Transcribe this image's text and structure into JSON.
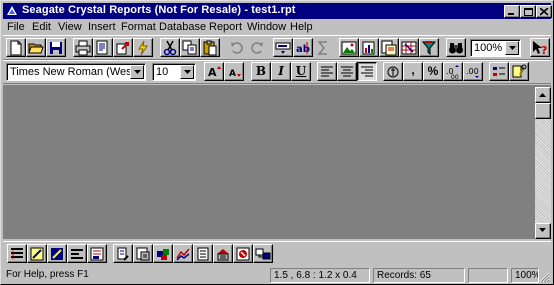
{
  "window": {
    "title": "Seagate Crystal Reports (Not For Resale) - test1.rpt"
  },
  "menu": [
    "File",
    "Edit",
    "View",
    "Insert",
    "Format",
    "Database",
    "Report",
    "Window",
    "Help"
  ],
  "toolbar": {
    "zoom_value": "100%",
    "buttons": [
      "new",
      "open",
      "save",
      "print",
      "print-preview",
      "export",
      "refresh",
      "cut",
      "copy",
      "paste",
      "undo",
      "redo",
      "insert-field",
      "insert-text",
      "insert-summary",
      "insert-picture",
      "insert-chart",
      "insert-subreport",
      "insert-crosstab",
      "select-expert",
      "zoom",
      "help"
    ]
  },
  "format_toolbar": {
    "font_name": "Times New Roman (Western",
    "font_size": "10",
    "bold_label": "B",
    "italic_label": "I",
    "underline_label": "U",
    "comma_label": ",",
    "percent_label": "%"
  },
  "bottom_toolbar": {
    "buttons": [
      "insert-group",
      "insert-section",
      "format-section",
      "section-expert",
      "field-explorer",
      "sort-records",
      "record-selection",
      "group-selection",
      "chart-expert",
      "report-explorer",
      "database-expert",
      "text-object",
      "subreport"
    ]
  },
  "status": {
    "help_text": "For Help, press F1",
    "position": "1.5 , 6.8 : 1.2 x 0.4",
    "records": "Records:  65",
    "zoom": "100%"
  },
  "colors": {
    "titlebar": "#000080",
    "chrome": "#c0c0c0",
    "workspace": "#808080"
  }
}
